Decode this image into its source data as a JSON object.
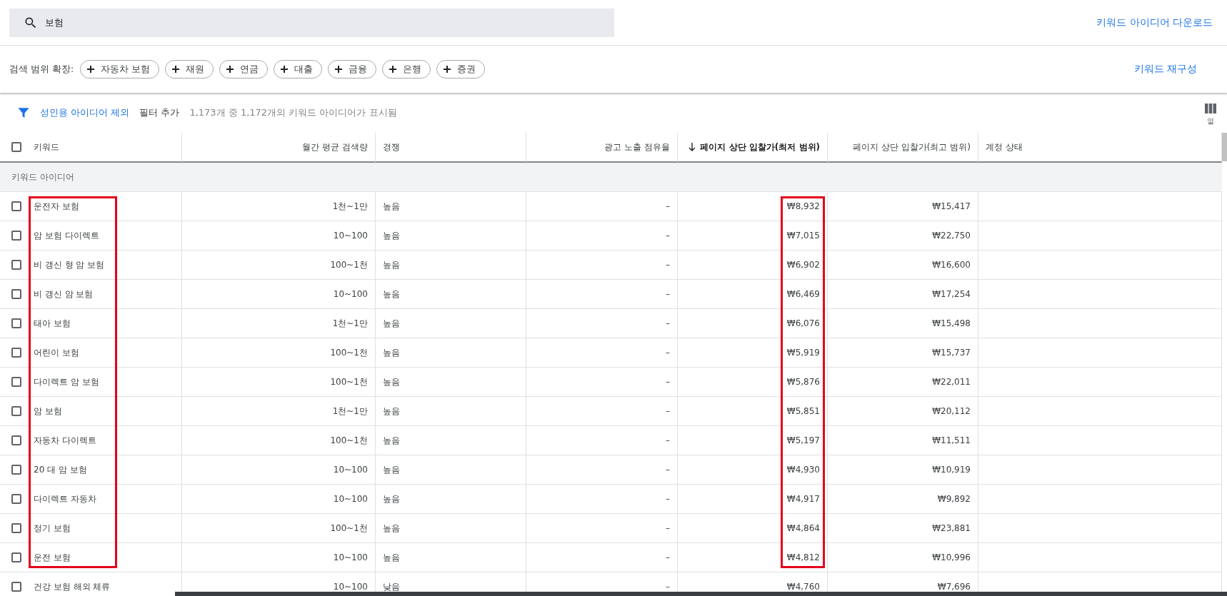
{
  "search": {
    "value": "보험"
  },
  "download_link": "키워드 아이디어 다운로드",
  "expand": {
    "label": "검색 범위 확장:",
    "chips": [
      {
        "label": "자동차 보험"
      },
      {
        "label": "재원"
      },
      {
        "label": "연금"
      },
      {
        "label": "대출"
      },
      {
        "label": "금융"
      },
      {
        "label": "은행"
      },
      {
        "label": "증권"
      }
    ],
    "refine_link": "키워드 재구성"
  },
  "filter_bar": {
    "active_filter": "성인용 아이디어 제외",
    "add_filter": "필터 추가",
    "summary": "1,173개 중 1,172개의 키워드 아이디어가 표시됨",
    "columns_button": "열"
  },
  "table": {
    "select_all_checked": false,
    "columns": [
      {
        "label": "키워드",
        "kind": "text",
        "sorted": false
      },
      {
        "label": "월간 평균 검색량",
        "kind": "number",
        "sorted": false
      },
      {
        "label": "경쟁",
        "kind": "text",
        "sorted": false
      },
      {
        "label": "광고 노출 점유율",
        "kind": "number",
        "sorted": false
      },
      {
        "label": "페이지 상단 입찰가(최저 범위)",
        "kind": "number",
        "sorted": true
      },
      {
        "label": "페이지 상단 입찰가(최고 범위)",
        "kind": "number",
        "sorted": false
      },
      {
        "label": "계정 상태",
        "kind": "text",
        "sorted": false
      }
    ],
    "group_label": "키워드 아이디어",
    "rows": [
      {
        "checked": false,
        "highlighted": true,
        "cells": [
          "운전자 보험",
          "1천~1만",
          "높음",
          "–",
          "₩8,932",
          "₩15,417"
        ]
      },
      {
        "checked": false,
        "highlighted": true,
        "cells": [
          "암 보험 다이렉트",
          "10~100",
          "높음",
          "–",
          "₩7,015",
          "₩22,750"
        ]
      },
      {
        "checked": false,
        "highlighted": true,
        "cells": [
          "비 갱신 형 암 보험",
          "100~1천",
          "높음",
          "–",
          "₩6,902",
          "₩16,600"
        ]
      },
      {
        "checked": false,
        "highlighted": true,
        "cells": [
          "비 갱신 암 보험",
          "10~100",
          "높음",
          "–",
          "₩6,469",
          "₩17,254"
        ]
      },
      {
        "checked": false,
        "highlighted": true,
        "cells": [
          "태아 보험",
          "1천~1만",
          "높음",
          "–",
          "₩6,076",
          "₩15,498"
        ]
      },
      {
        "checked": false,
        "highlighted": true,
        "cells": [
          "어린이 보험",
          "100~1천",
          "높음",
          "–",
          "₩5,919",
          "₩15,737"
        ]
      },
      {
        "checked": false,
        "highlighted": true,
        "cells": [
          "다이렉트 암 보험",
          "100~1천",
          "높음",
          "–",
          "₩5,876",
          "₩22,011"
        ]
      },
      {
        "checked": false,
        "highlighted": true,
        "cells": [
          "암 보험",
          "1천~1만",
          "높음",
          "–",
          "₩5,851",
          "₩20,112"
        ]
      },
      {
        "checked": false,
        "highlighted": true,
        "cells": [
          "자동차 다이렉트",
          "100~1천",
          "높음",
          "–",
          "₩5,197",
          "₩11,511"
        ]
      },
      {
        "checked": false,
        "highlighted": true,
        "cells": [
          "20 대 암 보험",
          "10~100",
          "높음",
          "–",
          "₩4,930",
          "₩10,919"
        ]
      },
      {
        "checked": false,
        "highlighted": true,
        "cells": [
          "다이렉트 자동차",
          "10~100",
          "높음",
          "–",
          "₩4,917",
          "₩9,892"
        ]
      },
      {
        "checked": false,
        "highlighted": true,
        "cells": [
          "정기 보험",
          "100~1천",
          "높음",
          "–",
          "₩4,864",
          "₩23,881"
        ]
      },
      {
        "checked": false,
        "highlighted": true,
        "cells": [
          "운전 보험",
          "10~100",
          "높음",
          "–",
          "₩4,812",
          "₩10,996"
        ]
      },
      {
        "checked": false,
        "highlighted": false,
        "cells": [
          "건강 보험 해외 체류",
          "10~100",
          "낮음",
          "–",
          "₩4,760",
          "₩7,696"
        ]
      }
    ]
  }
}
